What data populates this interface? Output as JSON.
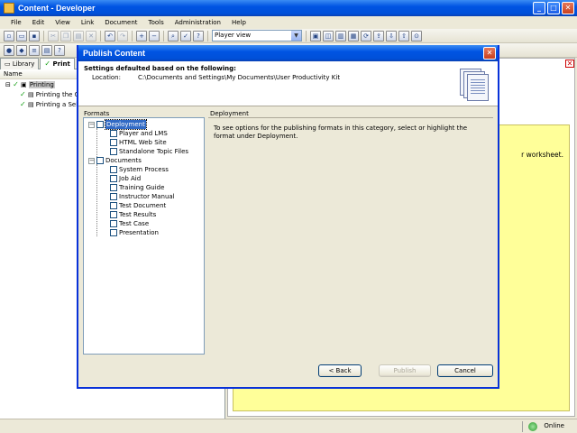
{
  "window": {
    "title": "Content - Developer"
  },
  "menu": [
    "File",
    "Edit",
    "View",
    "Link",
    "Document",
    "Tools",
    "Administration",
    "Help"
  ],
  "toolbar": {
    "view_select": "Player view"
  },
  "left_panel": {
    "tabs": [
      "Library",
      "Print"
    ],
    "column_header": "Name",
    "tree": [
      {
        "label": "Printing",
        "level": 0,
        "selected": true
      },
      {
        "label": "Printing the C",
        "level": 1
      },
      {
        "label": "Printing a Sel",
        "level": 1
      }
    ]
  },
  "editor": {
    "yellow_text": "r worksheet."
  },
  "status": {
    "connection": "Online"
  },
  "dialog": {
    "title": "Publish Content",
    "heading": "Settings defaulted based on the following:",
    "location_label": "Location:",
    "location_value": "C:\\Documents and Settings\\My Documents\\User Productivity Kit",
    "formats_label": "Formats",
    "deployment_label": "Deployment",
    "deployment_text": "To see options for the publishing formats in this category, select or highlight the format under Deployment.",
    "formats": {
      "deployment": {
        "label": "Deployment",
        "items": [
          "Player and LMS",
          "HTML Web Site",
          "Standalone Topic Files"
        ]
      },
      "documents": {
        "label": "Documents",
        "items": [
          "System Process",
          "Job Aid",
          "Training Guide",
          "Instructor Manual",
          "Test Document",
          "Test Results",
          "Test Case",
          "Presentation"
        ]
      }
    },
    "buttons": {
      "back": "< Back",
      "publish": "Publish",
      "cancel": "Cancel"
    }
  }
}
